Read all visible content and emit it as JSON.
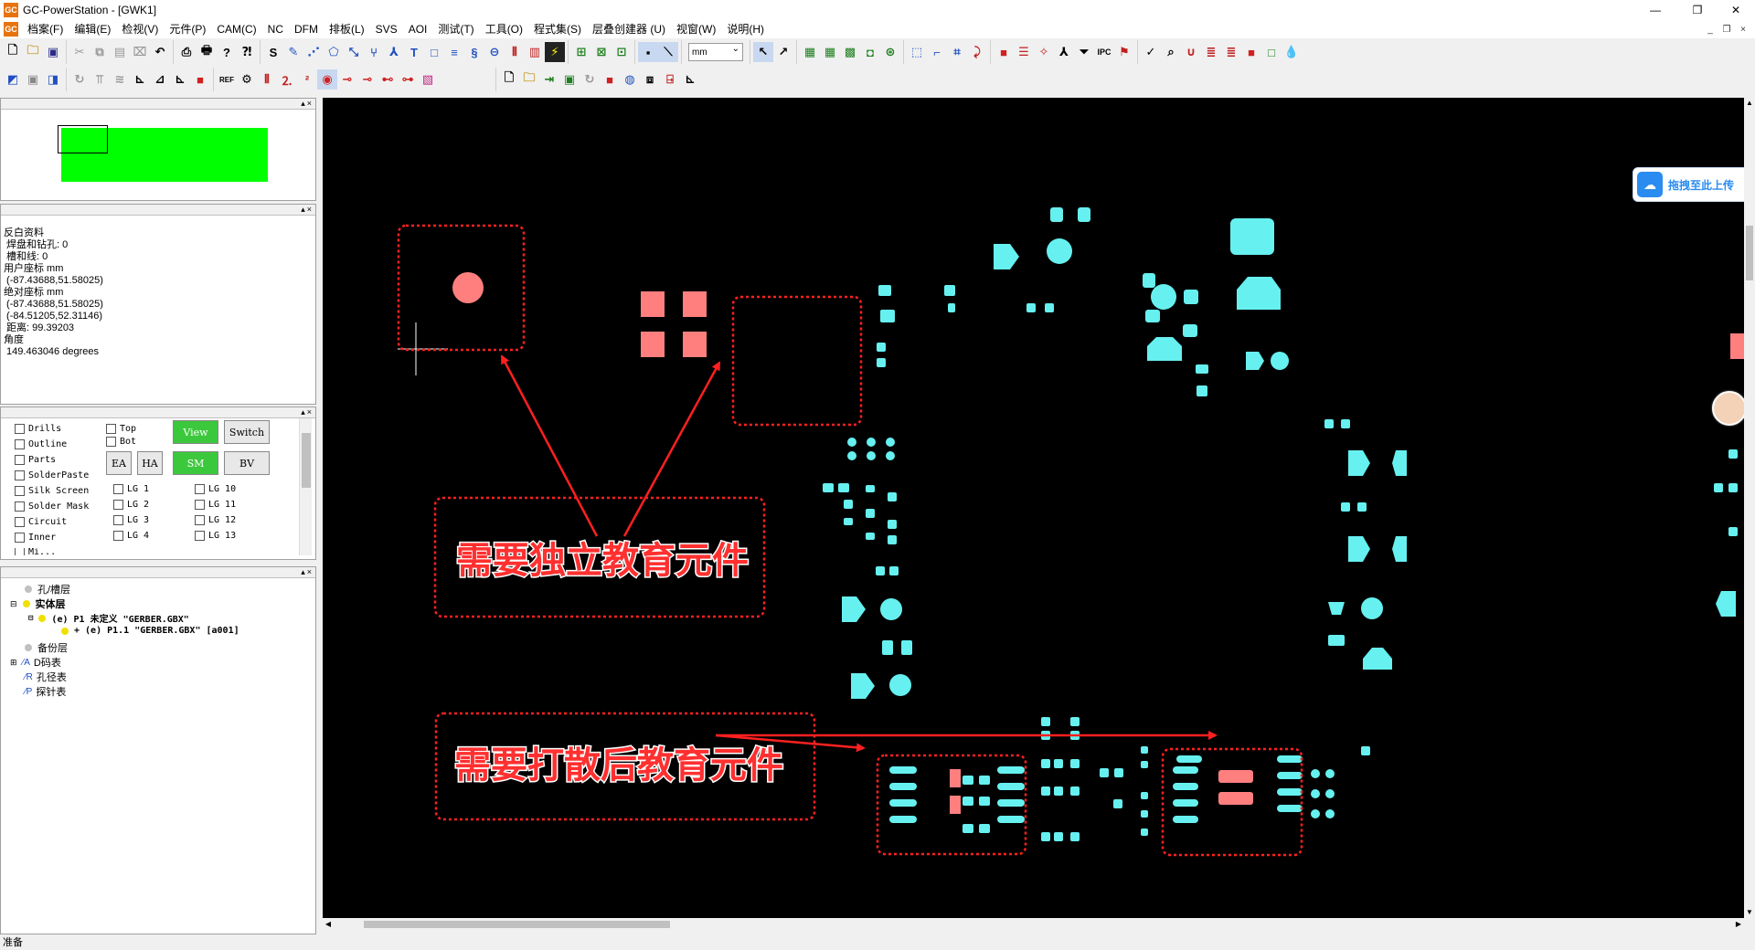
{
  "window": {
    "title": "GC-PowerStation - [GWK1]",
    "app_icon_text": "GC",
    "controls": [
      "—",
      "❐",
      "✕"
    ]
  },
  "menubar": {
    "items": [
      "档案(F)",
      "编辑(E)",
      "检视(V)",
      "元件(P)",
      "CAM(C)",
      "NC",
      "DFM",
      "排板(L)",
      "SVS",
      "AOI",
      "测试(T)",
      "工具(O)",
      "程式集(S)",
      "层叠创建器 (U)",
      "视窗(W)",
      "说明(H)"
    ],
    "mdi_controls": [
      "_",
      "❐",
      "×"
    ]
  },
  "toolbar": {
    "unit_select": "mm"
  },
  "preview_panel": {
    "accent": "#00ff00"
  },
  "info_panel": {
    "lines": [
      "反白资料",
      " 焊盘和钻孔: 0",
      " 槽和线: 0",
      "",
      "用户座标 mm",
      " (-87.43688,51.58025)",
      "绝对座标 mm",
      " (-87.43688,51.58025)",
      "",
      "",
      " (-84.51205,52.31146)",
      " 距离: 99.39203",
      "角度",
      " 149.463046 degrees"
    ]
  },
  "layers_panel": {
    "left_checks": [
      "Drills",
      "Outline",
      "Parts",
      "SolderPaste",
      "Silk Screen",
      "Solder Mask",
      "Circuit",
      "Inner",
      "Mi..."
    ],
    "side_checks": [
      "Top",
      "Bot"
    ],
    "buttons": [
      "View",
      "Switch",
      "EA",
      "HA",
      "SM",
      "BV"
    ],
    "lg_checks": [
      "LG 1",
      "LG 2",
      "LG 3",
      "LG 4",
      "LG 10",
      "LG 11",
      "LG 12",
      "LG 13"
    ]
  },
  "tree_panel": {
    "items": [
      {
        "text": "孔/槽层",
        "bold": false
      },
      {
        "text": "实体层",
        "bold": true
      },
      {
        "text": "(e) P1 未定义 \"GERBER.GBX\"",
        "bold": true
      },
      {
        "text": "+ (e) P1.1 \"GERBER.GBX\" [a001]",
        "bold": true
      },
      {
        "text": "备份层",
        "bold": false
      },
      {
        "text": "D码表",
        "bold": false
      },
      {
        "text": "孔径表",
        "bold": false
      },
      {
        "text": "探针表",
        "bold": false
      }
    ]
  },
  "canvas": {
    "annotation_1": "需要独立教育元件",
    "annotation_2": "需要打散后教育元件",
    "pad_color": "#66f0f0",
    "highlight_color": "#ff7f7f",
    "annotation_color": "#ff0000"
  },
  "upload_badge": {
    "text": "拖拽至此上传"
  },
  "statusbar": {
    "text": "准备"
  }
}
